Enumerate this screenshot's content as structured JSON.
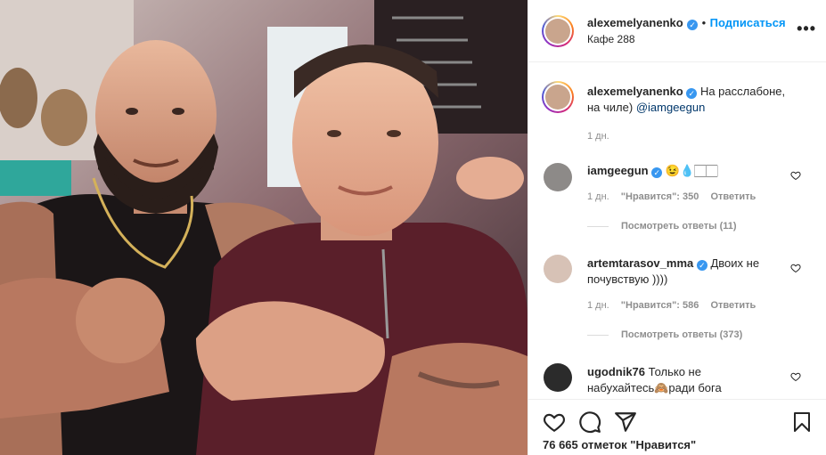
{
  "post": {
    "author": "alexemelyanenko",
    "verified_mark": "✓",
    "follow_label": "Подписаться",
    "bullet": "•",
    "location": "Кафе 288",
    "more_icon": "•••"
  },
  "caption": {
    "author": "alexemelyanenko",
    "text_line1": "На расслабоне,",
    "text_line2": "на чиле)",
    "mention": "@iamgeegun",
    "time": "1 дн."
  },
  "comments": [
    {
      "user": "iamgeegun",
      "text": "😉💧🏻🏻",
      "time": "1 дн.",
      "likes": "\"Нравится\": 350",
      "reply_label": "Ответить",
      "view_replies": "Посмотреть ответы (11)"
    },
    {
      "user": "artemtarasov_mma",
      "text_line1": "Двоих не",
      "text_line2": "почувствую ))))",
      "time": "1 дн.",
      "likes": "\"Нравится\": 586",
      "reply_label": "Ответить",
      "view_replies": "Посмотреть ответы (373)"
    },
    {
      "user": "ugodnik76",
      "text_line1": "Только не",
      "text_line2": "набухайтесь🙈ради бога"
    }
  ],
  "footer": {
    "likes_count": "76 665 отметок \"Нравится\""
  },
  "icons": {
    "heart": "heart-icon",
    "comment": "comment-icon",
    "share": "share-icon",
    "save": "bookmark-icon"
  },
  "colors": {
    "accent": "#0095f6",
    "verified": "#3897f0",
    "text": "#262626",
    "muted": "#8e8e8e",
    "divider": "#efefef"
  }
}
